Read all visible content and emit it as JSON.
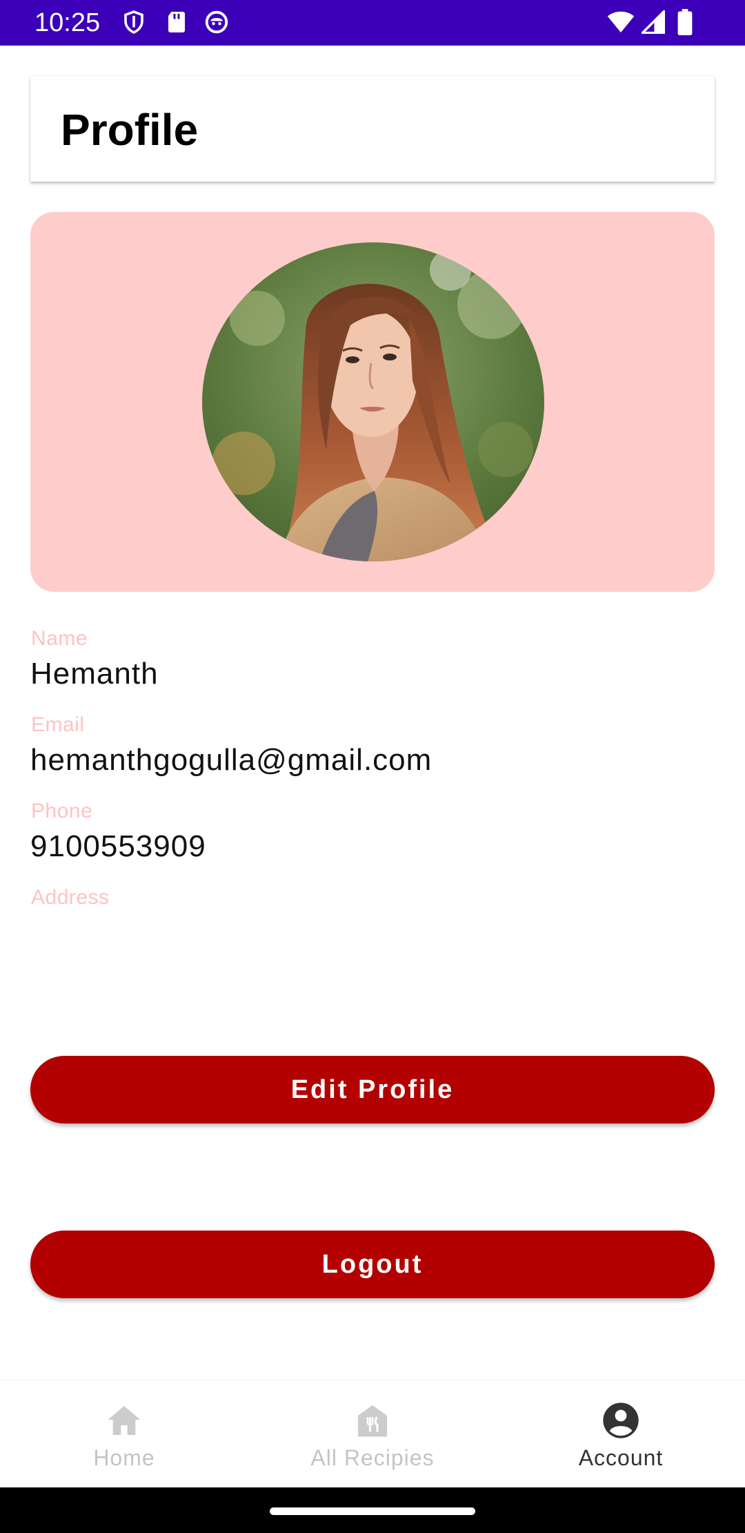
{
  "status_bar": {
    "time": "10:25",
    "icons": [
      "shield-icon",
      "sd-card-icon",
      "face-icon",
      "wifi-icon",
      "signal-icon",
      "battery-icon"
    ],
    "background": "#3b00b8"
  },
  "header": {
    "title": "Profile"
  },
  "profile_card": {
    "background": "#ffcccc",
    "avatar": "profile-photo"
  },
  "fields": [
    {
      "label": "Name",
      "value": "Hemanth"
    },
    {
      "label": "Email",
      "value": "hemanthgogulla@gmail.com"
    },
    {
      "label": "Phone",
      "value": "9100553909"
    },
    {
      "label": "Address",
      "value": ""
    }
  ],
  "buttons": {
    "edit_profile": "Edit Profile",
    "logout": "Logout"
  },
  "bottom_nav": {
    "items": [
      {
        "label": "Home",
        "icon": "home-icon",
        "active": false
      },
      {
        "label": "All Recipies",
        "icon": "recipes-icon",
        "active": false
      },
      {
        "label": "Account",
        "icon": "account-icon",
        "active": true
      }
    ]
  },
  "colors": {
    "accent": "#b30000",
    "label": "#ffc2c2",
    "card": "#ffcccc",
    "status_bar": "#3b00b8"
  }
}
